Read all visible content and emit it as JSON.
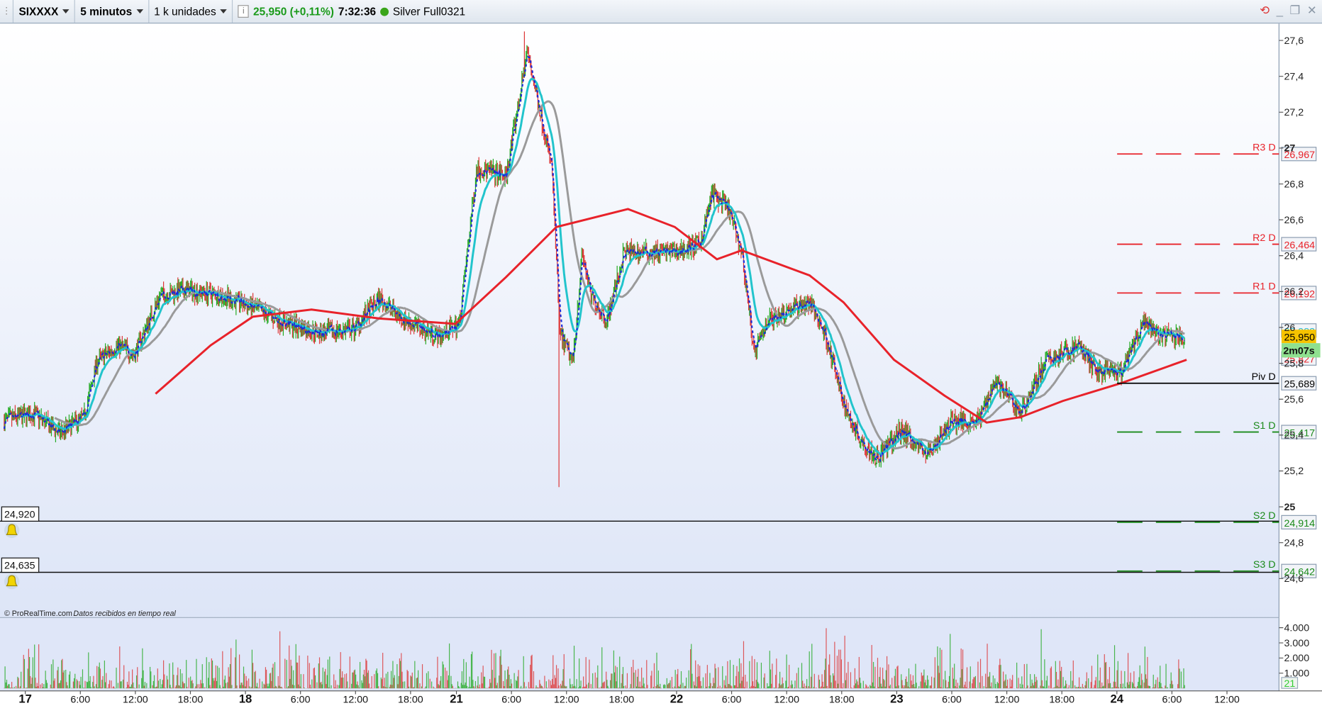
{
  "toolbar": {
    "symbol": "SIXXXX",
    "timeframe": "5 minutos",
    "units": "1 k unidades",
    "price": "25,950 (+0,11%)",
    "time": "7:32:36",
    "feed": "Silver Full0321",
    "price_color": "#1a9a1a"
  },
  "footer": {
    "copyright": "© ProRealTime.com",
    "status": "Datos recibidos en tiempo real"
  },
  "alerts": [
    {
      "label": "24,920",
      "price": 24.92
    },
    {
      "label": "24,635",
      "price": 24.635
    }
  ],
  "countdown": "2m07s",
  "chart_data": {
    "type": "candlestick",
    "ylim": [
      24.55,
      27.7
    ],
    "y_ticks": [
      "27,6",
      "27,4",
      "27,2",
      "27",
      "26,8",
      "26,6",
      "26,4",
      "26,2",
      "26",
      "25,8",
      "25,6",
      "25,4",
      "25,2",
      "25",
      "24,8",
      "24,6"
    ],
    "y_tick_values": [
      27.6,
      27.4,
      27.2,
      27,
      26.8,
      26.6,
      26.4,
      26.2,
      26,
      25.8,
      25.6,
      25.4,
      25.2,
      25,
      24.8,
      24.6
    ],
    "x_ticks": [
      {
        "t": 0,
        "label": "17",
        "bold": true
      },
      {
        "t": 6,
        "label": "6:00"
      },
      {
        "t": 12,
        "label": "12:00"
      },
      {
        "t": 18,
        "label": "18:00"
      },
      {
        "t": 24,
        "label": "18",
        "bold": true
      },
      {
        "t": 30,
        "label": "6:00"
      },
      {
        "t": 36,
        "label": "12:00"
      },
      {
        "t": 42,
        "label": "18:00"
      },
      {
        "t": 47,
        "label": "21",
        "bold": true
      },
      {
        "t": 53,
        "label": "6:00"
      },
      {
        "t": 59,
        "label": "12:00"
      },
      {
        "t": 65,
        "label": "18:00"
      },
      {
        "t": 71,
        "label": "22",
        "bold": true
      },
      {
        "t": 77,
        "label": "6:00"
      },
      {
        "t": 83,
        "label": "12:00"
      },
      {
        "t": 89,
        "label": "18:00"
      },
      {
        "t": 95,
        "label": "23",
        "bold": true
      },
      {
        "t": 101,
        "label": "6:00"
      },
      {
        "t": 107,
        "label": "12:00"
      },
      {
        "t": 113,
        "label": "18:00"
      },
      {
        "t": 119,
        "label": "24",
        "bold": true
      },
      {
        "t": 125,
        "label": "6:00"
      },
      {
        "t": 131,
        "label": "12:00"
      }
    ],
    "close_path": [
      [
        -2.3,
        25.48
      ],
      [
        0.9,
        25.52
      ],
      [
        3.7,
        25.41
      ],
      [
        6.4,
        25.5
      ],
      [
        7.8,
        25.81
      ],
      [
        10.1,
        25.9
      ],
      [
        11.9,
        25.85
      ],
      [
        14.7,
        26.18
      ],
      [
        17.5,
        26.21
      ],
      [
        21.1,
        26.18
      ],
      [
        24.8,
        26.11
      ],
      [
        28.5,
        26.02
      ],
      [
        32.2,
        25.97
      ],
      [
        35.8,
        25.99
      ],
      [
        38.6,
        26.16
      ],
      [
        41.4,
        26.04
      ],
      [
        45,
        25.95
      ],
      [
        47.3,
        26.02
      ],
      [
        49.2,
        26.89
      ],
      [
        52.4,
        26.84
      ],
      [
        53.8,
        27.26
      ],
      [
        54.7,
        27.54
      ],
      [
        56.1,
        27.21
      ],
      [
        57.4,
        26.89
      ],
      [
        58.3,
        25.95
      ],
      [
        59.7,
        25.81
      ],
      [
        60.7,
        26.42
      ],
      [
        61.6,
        26.18
      ],
      [
        63.4,
        26.04
      ],
      [
        65.3,
        26.42
      ],
      [
        67.1,
        26.42
      ],
      [
        70.8,
        26.42
      ],
      [
        73.5,
        26.46
      ],
      [
        74.9,
        26.75
      ],
      [
        76.7,
        26.65
      ],
      [
        78.1,
        26.42
      ],
      [
        79.5,
        25.85
      ],
      [
        80.9,
        26.04
      ],
      [
        83.6,
        26.11
      ],
      [
        85.5,
        26.14
      ],
      [
        87.3,
        25.95
      ],
      [
        89.2,
        25.57
      ],
      [
        91,
        25.38
      ],
      [
        92.8,
        25.27
      ],
      [
        95.6,
        25.43
      ],
      [
        98.3,
        25.29
      ],
      [
        101.1,
        25.48
      ],
      [
        103.9,
        25.48
      ],
      [
        105.7,
        25.71
      ],
      [
        108.5,
        25.52
      ],
      [
        111.2,
        25.81
      ],
      [
        114.9,
        25.9
      ],
      [
        116.7,
        25.76
      ],
      [
        119.5,
        25.74
      ],
      [
        121.8,
        26.02
      ],
      [
        124.1,
        25.95
      ],
      [
        126.4,
        25.95
      ]
    ],
    "extreme_low": {
      "t": 58.2,
      "price": 25.11
    },
    "extreme_high": {
      "t": 54.4,
      "price": 27.65
    },
    "slow_ma": [
      [
        14.2,
        25.63
      ],
      [
        20.2,
        25.9
      ],
      [
        24.8,
        26.06
      ],
      [
        31.2,
        26.1
      ],
      [
        38.6,
        26.05
      ],
      [
        46.9,
        26.02
      ],
      [
        52.4,
        26.28
      ],
      [
        57.9,
        26.56
      ],
      [
        65.7,
        26.66
      ],
      [
        70.8,
        26.56
      ],
      [
        75.4,
        26.38
      ],
      [
        78.1,
        26.43
      ],
      [
        85.5,
        26.29
      ],
      [
        89.2,
        26.14
      ],
      [
        94.7,
        25.82
      ],
      [
        100.2,
        25.62
      ],
      [
        104.8,
        25.47
      ],
      [
        108.5,
        25.5
      ],
      [
        113.1,
        25.59
      ],
      [
        119.5,
        25.69
      ],
      [
        126.6,
        25.82
      ]
    ],
    "levels": [
      {
        "name": "R3 D",
        "value": 26.967,
        "label": "26,967",
        "color": "#e8222a"
      },
      {
        "name": "R2 D",
        "value": 26.464,
        "label": "26,464",
        "color": "#e8222a"
      },
      {
        "name": "R1 D",
        "value": 26.192,
        "label": "26,192",
        "color": "#e8222a"
      },
      {
        "name": "Piv D",
        "value": 25.689,
        "label": "25,689",
        "color": "#000000"
      },
      {
        "name": "S1 D",
        "value": 25.417,
        "label": "25,417",
        "color": "#1a8a1a"
      },
      {
        "name": "S2 D",
        "value": 24.914,
        "label": "24,914",
        "color": "#1a8a1a"
      },
      {
        "name": "S3 D",
        "value": 24.642,
        "label": "24,642",
        "color": "#1a8a1a"
      }
    ],
    "price_tags": [
      {
        "label": "25,983",
        "value": 25.983,
        "color": "#27b8c8"
      },
      {
        "label": "25,950",
        "value": 25.95,
        "color": "#000000",
        "bg": "#f6c300"
      },
      {
        "label": "25,827",
        "value": 25.827,
        "color": "#e8222a"
      }
    ],
    "volume": {
      "y_ticks": [
        "4.000",
        "3.000",
        "2.000",
        "1.000"
      ],
      "y_tick_values": [
        4000,
        3000,
        2000,
        1000
      ],
      "last": "21"
    }
  }
}
